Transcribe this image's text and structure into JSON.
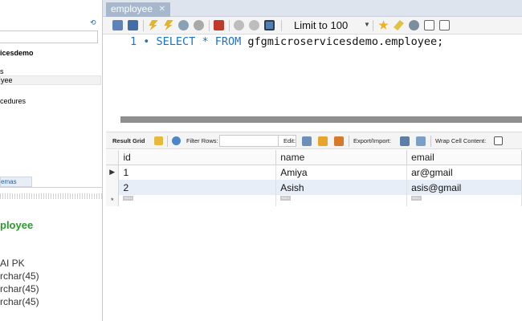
{
  "tabs": [
    {
      "label": "employee"
    }
  ],
  "toolbar": {
    "limit_label": "Limit to 100"
  },
  "editor": {
    "line_number": "1",
    "sql_keywords": [
      "SELECT",
      "*",
      "FROM"
    ],
    "sql_table": "gfgmicroservicesdemo.employee;"
  },
  "left_panel": {
    "schema_name": "icesdemo",
    "tables_label": "s",
    "selected_table": "yee",
    "procedures_label": "cedures",
    "schemas_tab": "emas",
    "info_title": "ployee",
    "columns": [
      {
        "text": "AI PK"
      },
      {
        "text": "rchar(45)"
      },
      {
        "text": "rchar(45)"
      },
      {
        "text": "rchar(45)"
      }
    ]
  },
  "result_toolbar": {
    "result_grid_label": "Result Grid",
    "filter_rows_label": "Filter Rows:",
    "edit_label": "Edit:",
    "export_label": "Export/Import:",
    "wrap_label": "Wrap Cell Content:"
  },
  "grid": {
    "columns": [
      "id",
      "name",
      "email"
    ],
    "rows": [
      {
        "marker": "▶",
        "cells": [
          "1",
          "Amiya",
          "ar@gmail"
        ]
      },
      {
        "marker": "",
        "cells": [
          "2",
          "Asish",
          "asis@gmail"
        ]
      }
    ],
    "new_row": {
      "marker": "*",
      "null_label": "NULL"
    }
  },
  "colors": {
    "keyword": "#1a72c9",
    "tab_active": "#a8b8cc",
    "info_title": "#2a9a2a",
    "row_alt": "#e8eef8"
  }
}
